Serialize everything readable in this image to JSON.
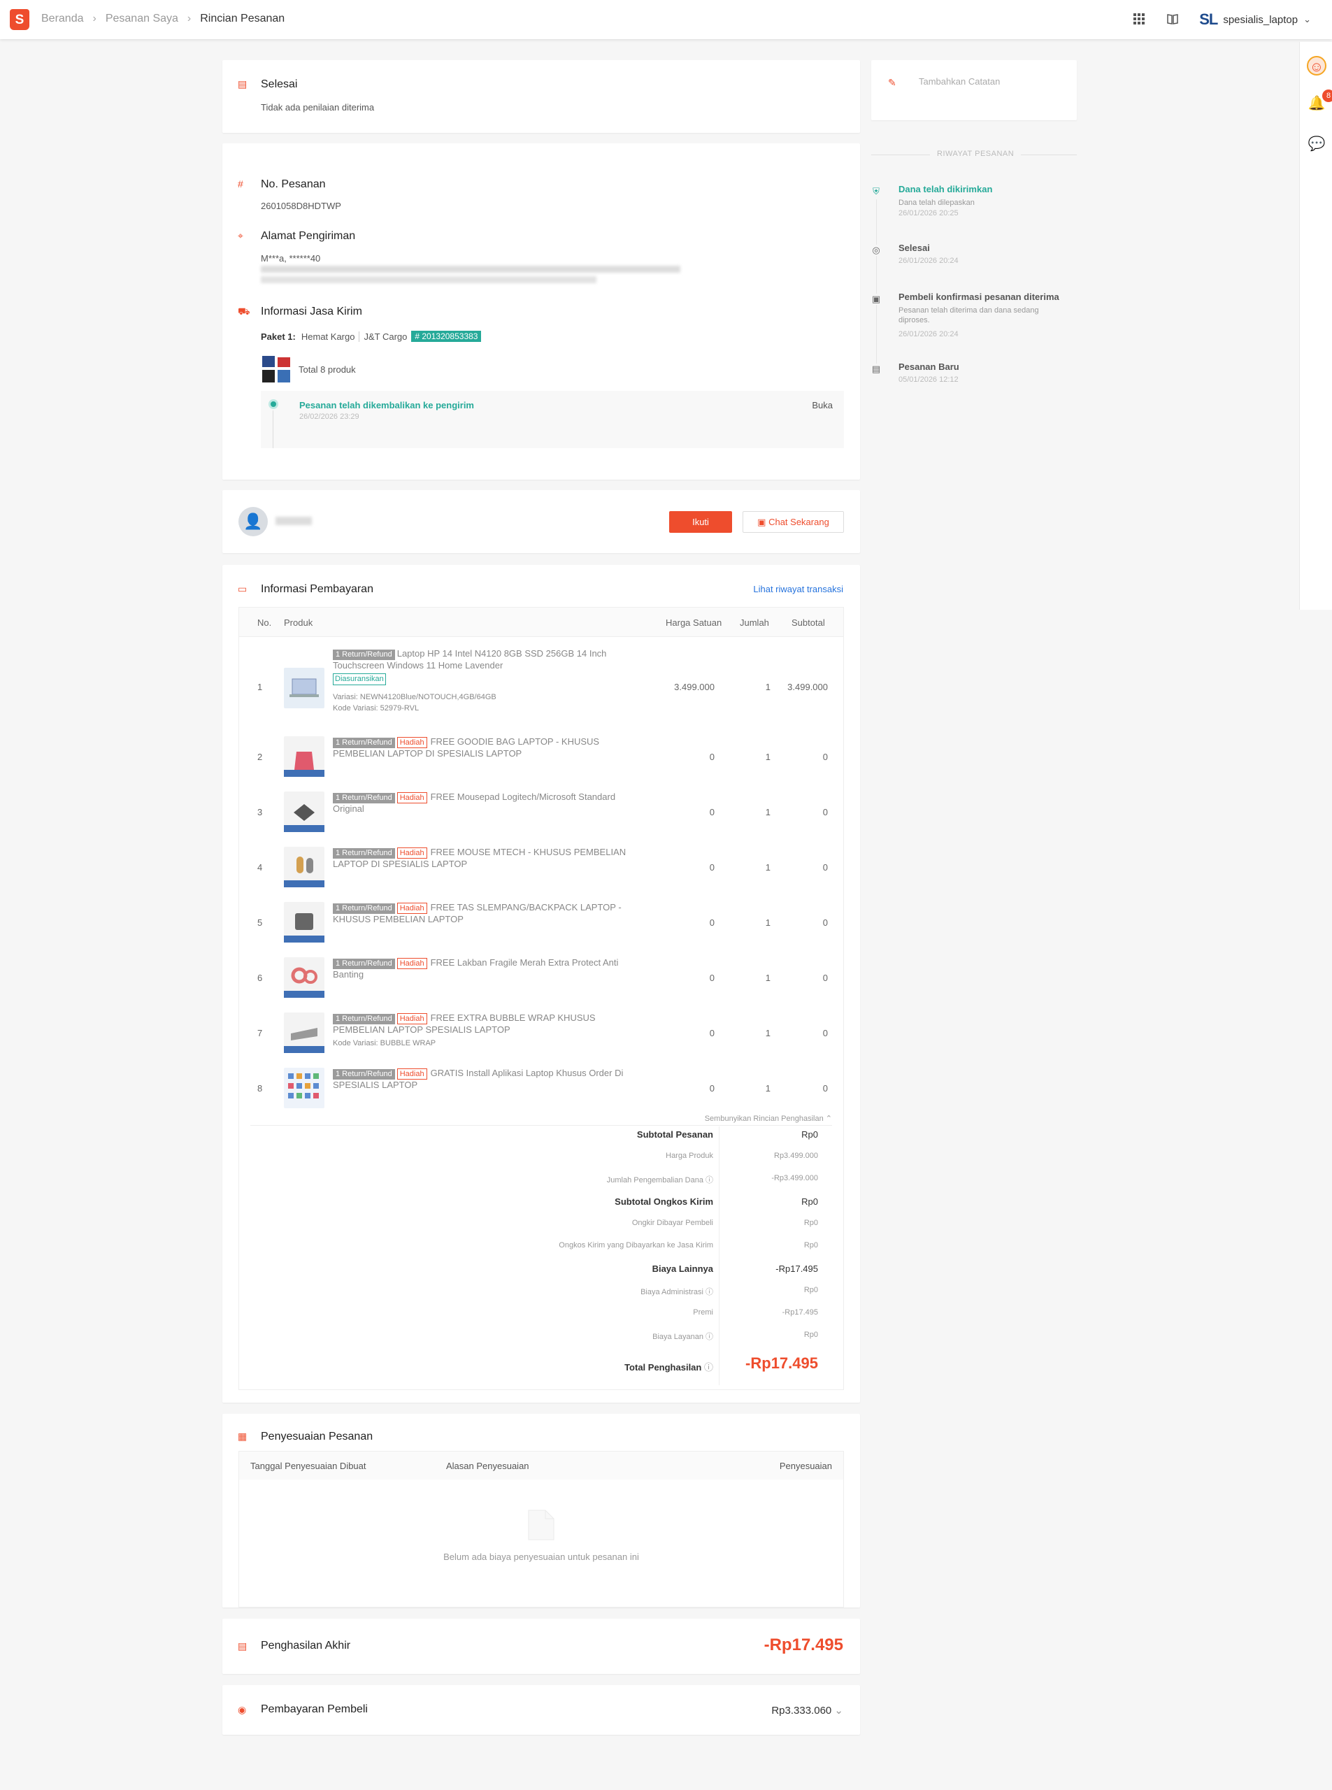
{
  "topbar": {
    "logo": "S",
    "breadcrumb": [
      "Beranda",
      "Pesanan Saya",
      "Rincian Pesanan"
    ],
    "shop_logo": "SL",
    "shop_name": "spesialis_laptop"
  },
  "status": {
    "title": "Selesai",
    "subtitle": "Tidak ada penilaian diterima"
  },
  "order": {
    "no_label": "No. Pesanan",
    "no_value": "2601058D8HDTWP",
    "address_label": "Alamat Pengiriman",
    "address_name": "M***a, ******40",
    "shipping_label": "Informasi Jasa Kirim",
    "package_label": "Paket 1:",
    "shipping_method": "Hemat Kargo",
    "courier": "J&T Cargo",
    "tracking": "# 201320853383",
    "total_products": "Total 8 produk",
    "tracking_event": "Pesanan telah dikembalikan ke pengirim",
    "tracking_time": "26/02/2026 23:29",
    "open_label": "Buka"
  },
  "buyer": {
    "follow_label": "Ikuti",
    "chat_label": "Chat Sekarang"
  },
  "payment": {
    "title": "Informasi Pembayaran",
    "history_link": "Lihat riwayat transaksi",
    "columns": [
      "No.",
      "Produk",
      "Harga Satuan",
      "Jumlah",
      "Subtotal"
    ],
    "return_tag": "1 Return/Refund",
    "gift_tag": "Hadiah",
    "insured_tag": "Diasuransikan",
    "products": [
      {
        "no": "1",
        "name": "Laptop HP 14 Intel N4120 8GB SSD 256GB 14 Inch Touchscreen Windows 11 Home Lavender",
        "variant": "Variasi: NEWN4120Blue/NOTOUCH,4GB/64GB",
        "code": "Kode Variasi: 52979-RVL",
        "price": "3.499.000",
        "qty": "1",
        "subtotal": "3.499.000"
      },
      {
        "no": "2",
        "name": "FREE GOODIE BAG LAPTOP - KHUSUS PEMBELIAN LAPTOP DI SPESIALIS LAPTOP",
        "price": "0",
        "qty": "1",
        "subtotal": "0"
      },
      {
        "no": "3",
        "name": "FREE Mousepad Logitech/Microsoft Standard Original",
        "price": "0",
        "qty": "1",
        "subtotal": "0"
      },
      {
        "no": "4",
        "name": "FREE MOUSE MTECH - KHUSUS PEMBELIAN LAPTOP DI SPESIALIS LAPTOP",
        "price": "0",
        "qty": "1",
        "subtotal": "0"
      },
      {
        "no": "5",
        "name": "FREE TAS SLEMPANG/BACKPACK LAPTOP - KHUSUS PEMBELIAN LAPTOP",
        "price": "0",
        "qty": "1",
        "subtotal": "0"
      },
      {
        "no": "6",
        "name": "FREE Lakban Fragile Merah Extra Protect Anti Banting",
        "price": "0",
        "qty": "1",
        "subtotal": "0"
      },
      {
        "no": "7",
        "name": "FREE EXTRA BUBBLE WRAP KHUSUS PEMBELIAN LAPTOP SPESIALIS LAPTOP",
        "code": "Kode Variasi: BUBBLE WRAP",
        "price": "0",
        "qty": "1",
        "subtotal": "0"
      },
      {
        "no": "8",
        "name": "GRATIS Install Aplikasi Laptop Khusus Order Di SPESIALIS LAPTOP",
        "price": "0",
        "qty": "1",
        "subtotal": "0"
      }
    ],
    "hide_label": "Sembunyikan Rincian Penghasilan",
    "summary": [
      {
        "label": "Subtotal Pesanan",
        "value": "Rp0",
        "bold": true
      },
      {
        "label": "Harga Produk",
        "value": "Rp3.499.000"
      },
      {
        "label": "Jumlah Pengembalian Dana",
        "value": "-Rp3.499.000",
        "info": true
      },
      {
        "label": "Subtotal Ongkos Kirim",
        "value": "Rp0",
        "bold": true
      },
      {
        "label": "Ongkir Dibayar Pembeli",
        "value": "Rp0"
      },
      {
        "label": "Ongkos Kirim yang Dibayarkan ke Jasa Kirim",
        "value": "Rp0"
      },
      {
        "label": "Biaya Lainnya",
        "value": "-Rp17.495",
        "bold": true
      },
      {
        "label": "Biaya Administrasi",
        "value": "Rp0",
        "info": true
      },
      {
        "label": "Premi",
        "value": "-Rp17.495"
      },
      {
        "label": "Biaya Layanan",
        "value": "Rp0",
        "info": true
      }
    ],
    "total_label": "Total Penghasilan",
    "total_value": "-Rp17.495"
  },
  "adjustment": {
    "title": "Penyesuaian Pesanan",
    "col_date": "Tanggal Penyesuaian Dibuat",
    "col_reason": "Alasan Penyesuaian",
    "col_amount": "Penyesuaian",
    "empty": "Belum ada biaya penyesuaian untuk pesanan ini"
  },
  "final": {
    "label": "Penghasilan Akhir",
    "value": "-Rp17.495"
  },
  "buyer_payment": {
    "label": "Pembayaran Pembeli",
    "value": "Rp3.333.060"
  },
  "notes": {
    "add_label": "Tambahkan Catatan"
  },
  "history": {
    "title": "RIWAYAT PESANAN",
    "events": [
      {
        "title": "Dana telah dikirimkan",
        "sub": "Dana telah dilepaskan",
        "date": "26/01/2026 20:25"
      },
      {
        "title": "Selesai",
        "date": "26/01/2026 20:24"
      },
      {
        "title": "Pembeli konfirmasi pesanan diterima",
        "sub": "Pesanan telah diterima dan dana sedang diproses.",
        "date": "26/01/2026 20:24"
      },
      {
        "title": "Pesanan Baru",
        "date": "05/01/2026 12:12"
      }
    ]
  },
  "sidebar": {
    "notif_count": "8"
  },
  "colors": {
    "accent": "#ee4d2d",
    "teal": "#26aa99",
    "link": "#2673dd"
  }
}
